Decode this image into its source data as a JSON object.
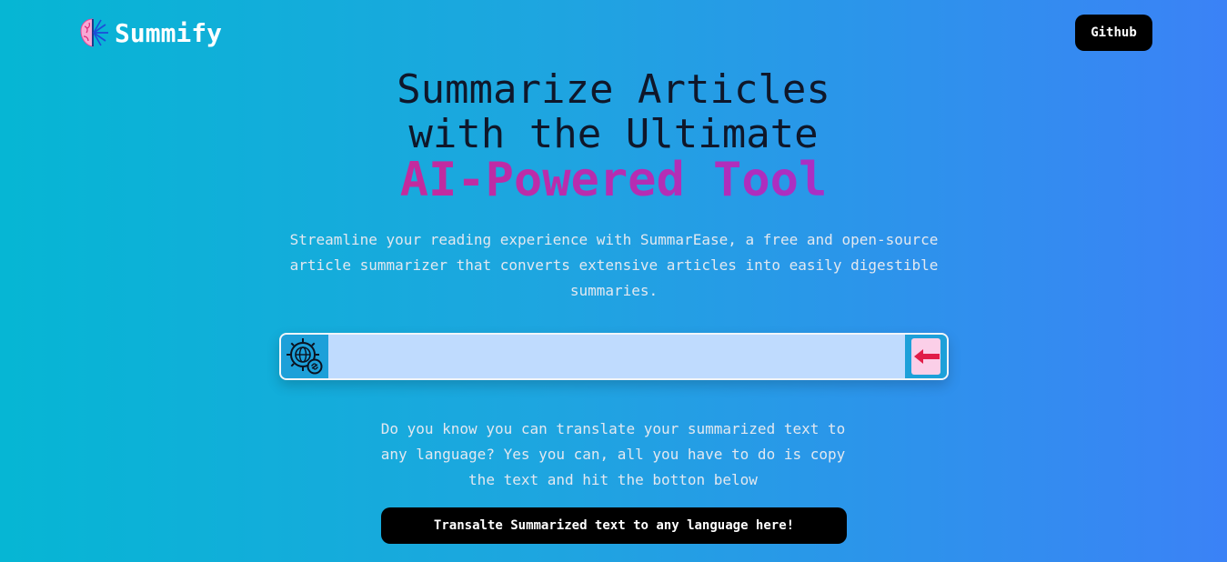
{
  "navbar": {
    "logo_icon": "brain-icon",
    "logo_text": "Summify",
    "github_label": "Github"
  },
  "hero": {
    "title_line1": "Summarize Articles",
    "title_line2": "with the Ultimate",
    "title_accent": "AI-Powered Tool",
    "description": "Streamline your reading experience with SummarEase, a free and open-source article summarizer that converts extensive articles into easily digestible summaries."
  },
  "search": {
    "link_icon": "globe-gear-link-icon",
    "input_value": "",
    "placeholder": "",
    "submit_icon": "arrow-left-icon"
  },
  "translate": {
    "note": "Do you know you can translate your summarized text to any language? Yes you can, all you have to do is copy the text and hit the botton below",
    "button_label": "Transalte Summarized text to any language here!"
  },
  "colors": {
    "background_start": "#06b6d4",
    "background_end": "#3b82f6",
    "accent_start": "#db2777",
    "accent_end": "#9333ea",
    "button_bg": "#000000",
    "input_bg": "#bfdbfe",
    "submit_bg": "#fbcfe8",
    "submit_arrow": "#e11d48"
  }
}
